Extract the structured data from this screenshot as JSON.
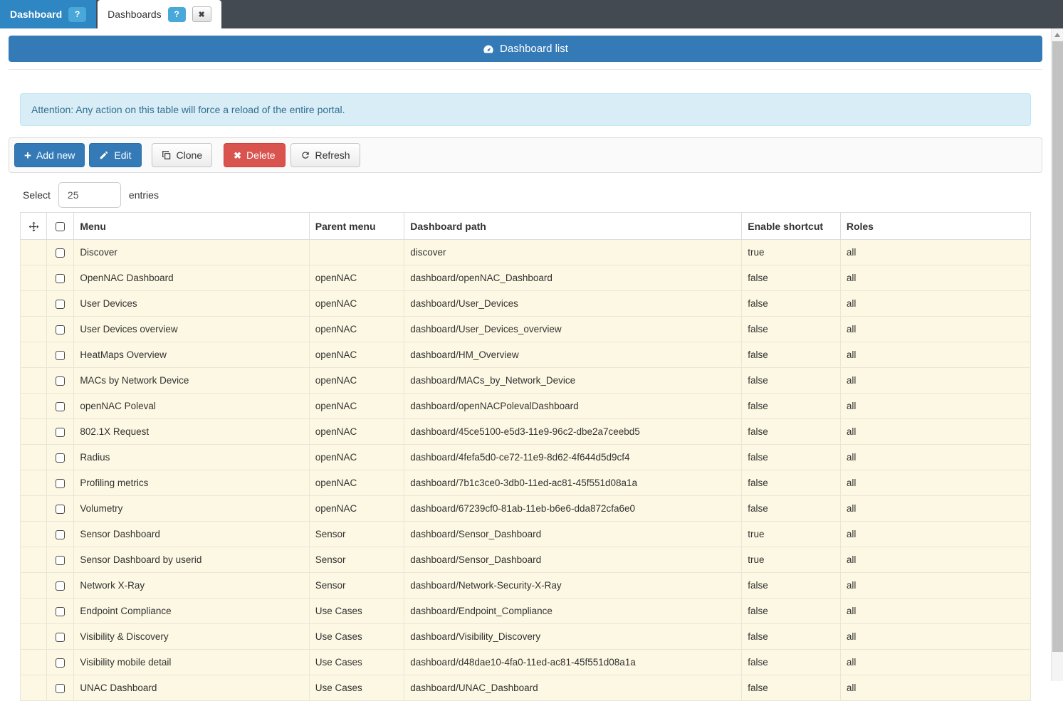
{
  "tabs": [
    {
      "label": "Dashboard",
      "help_label": "?"
    },
    {
      "label": "Dashboards",
      "help_label": "?",
      "close_label": "✖"
    }
  ],
  "panel": {
    "title": "Dashboard list"
  },
  "alert": {
    "text": "Attention: Any action on this table will force a reload of the entire portal."
  },
  "toolbar": {
    "add_label": "Add new",
    "add_icon": "+",
    "edit_label": "Edit",
    "clone_label": "Clone",
    "delete_label": "Delete",
    "delete_icon": "✖",
    "refresh_label": "Refresh"
  },
  "entries": {
    "label_before": "Select",
    "value": "25",
    "label_after": "entries"
  },
  "table": {
    "headers": {
      "menu": "Menu",
      "parent": "Parent menu",
      "path": "Dashboard path",
      "shortcut": "Enable shortcut",
      "roles": "Roles"
    },
    "rows": [
      {
        "menu": "Discover",
        "parent": "",
        "path": "discover",
        "shortcut": "true",
        "roles": "all"
      },
      {
        "menu": "OpenNAC Dashboard",
        "parent": "openNAC",
        "path": "dashboard/openNAC_Dashboard",
        "shortcut": "false",
        "roles": "all"
      },
      {
        "menu": "User Devices",
        "parent": "openNAC",
        "path": "dashboard/User_Devices",
        "shortcut": "false",
        "roles": "all"
      },
      {
        "menu": "User Devices overview",
        "parent": "openNAC",
        "path": "dashboard/User_Devices_overview",
        "shortcut": "false",
        "roles": "all"
      },
      {
        "menu": "HeatMaps Overview",
        "parent": "openNAC",
        "path": "dashboard/HM_Overview",
        "shortcut": "false",
        "roles": "all"
      },
      {
        "menu": "MACs by Network Device",
        "parent": "openNAC",
        "path": "dashboard/MACs_by_Network_Device",
        "shortcut": "false",
        "roles": "all"
      },
      {
        "menu": "openNAC Poleval",
        "parent": "openNAC",
        "path": "dashboard/openNACPolevalDashboard",
        "shortcut": "false",
        "roles": "all"
      },
      {
        "menu": "802.1X Request",
        "parent": "openNAC",
        "path": "dashboard/45ce5100-e5d3-11e9-96c2-dbe2a7ceebd5",
        "shortcut": "false",
        "roles": "all"
      },
      {
        "menu": "Radius",
        "parent": "openNAC",
        "path": "dashboard/4fefa5d0-ce72-11e9-8d62-4f644d5d9cf4",
        "shortcut": "false",
        "roles": "all"
      },
      {
        "menu": "Profiling metrics",
        "parent": "openNAC",
        "path": "dashboard/7b1c3ce0-3db0-11ed-ac81-45f551d08a1a",
        "shortcut": "false",
        "roles": "all"
      },
      {
        "menu": "Volumetry",
        "parent": "openNAC",
        "path": "dashboard/67239cf0-81ab-11eb-b6e6-dda872cfa6e0",
        "shortcut": "false",
        "roles": "all"
      },
      {
        "menu": "Sensor Dashboard",
        "parent": "Sensor",
        "path": "dashboard/Sensor_Dashboard",
        "shortcut": "true",
        "roles": "all"
      },
      {
        "menu": "Sensor Dashboard by userid",
        "parent": "Sensor",
        "path": "dashboard/Sensor_Dashboard",
        "shortcut": "true",
        "roles": "all"
      },
      {
        "menu": "Network X-Ray",
        "parent": "Sensor",
        "path": "dashboard/Network-Security-X-Ray",
        "shortcut": "false",
        "roles": "all"
      },
      {
        "menu": "Endpoint Compliance",
        "parent": "Use Cases",
        "path": "dashboard/Endpoint_Compliance",
        "shortcut": "false",
        "roles": "all"
      },
      {
        "menu": "Visibility & Discovery",
        "parent": "Use Cases",
        "path": "dashboard/Visibility_Discovery",
        "shortcut": "false",
        "roles": "all"
      },
      {
        "menu": "Visibility mobile detail",
        "parent": "Use Cases",
        "path": "dashboard/d48dae10-4fa0-11ed-ac81-45f551d08a1a",
        "shortcut": "false",
        "roles": "all"
      },
      {
        "menu": "UNAC Dashboard",
        "parent": "Use Cases",
        "path": "dashboard/UNAC_Dashboard",
        "shortcut": "false",
        "roles": "all"
      }
    ]
  },
  "colors": {
    "accent_blue": "#337ab7",
    "tab_blue": "#2e86c2",
    "badge_blue": "#49a7d9",
    "danger_red": "#d9534f",
    "row_bg": "#fcf8e3",
    "alert_bg": "#d9edf7",
    "alert_text": "#31708f",
    "tab_strip": "#434a52"
  }
}
